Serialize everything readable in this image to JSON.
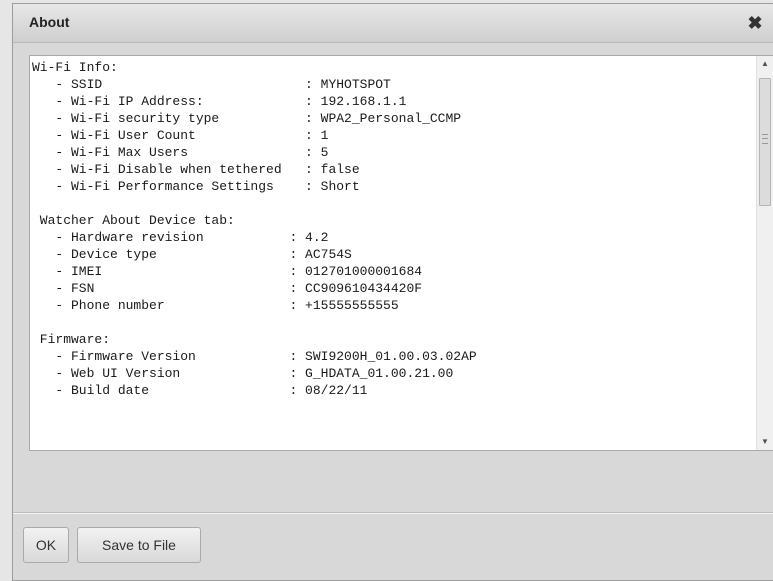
{
  "dialog": {
    "title": "About",
    "close_symbol": "✖",
    "close_icon": "close-icon"
  },
  "content": {
    "text": "Wi-Fi Info:\n   - SSID                          : MYHOTSPOT\n   - Wi-Fi IP Address:             : 192.168.1.1\n   - Wi-Fi security type           : WPA2_Personal_CCMP\n   - Wi-Fi User Count              : 1\n   - Wi-Fi Max Users               : 5\n   - Wi-Fi Disable when tethered   : false\n   - Wi-Fi Performance Settings    : Short\n\n Watcher About Device tab:\n   - Hardware revision           : 4.2\n   - Device type                 : AC754S\n   - IMEI                        : 012701000001684\n   - FSN                         : CC909610434420F\n   - Phone number                : +15555555555\n\n Firmware:\n   - Firmware Version            : SWI9200H_01.00.03.02AP\n   - Web UI Version              : G_HDATA_01.00.21.00\n   - Build date                  : 08/22/11"
  },
  "scrollbar": {
    "up_arrow": "▲",
    "down_arrow": "▼"
  },
  "buttons": {
    "ok_label": "OK",
    "save_label": "Save to File"
  }
}
